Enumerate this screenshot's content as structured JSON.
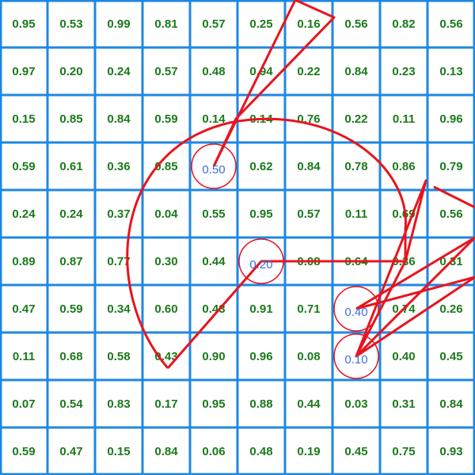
{
  "colors": {
    "grid_line": "#1e88e5",
    "cell_text": "#1b7a1b",
    "path": "#e8141e",
    "marker_text": "#3a6fd8",
    "background": "#ffffff"
  },
  "grid": {
    "rows": 10,
    "cols": 10,
    "values": [
      [
        "0.95",
        "0.53",
        "0.99",
        "0.81",
        "0.57",
        "0.25",
        "0.16",
        "0.56",
        "0.82",
        "0.56"
      ],
      [
        "0.97",
        "0.20",
        "0.24",
        "0.57",
        "0.48",
        "0.94",
        "0.22",
        "0.84",
        "0.23",
        "0.13"
      ],
      [
        "0.15",
        "0.85",
        "0.84",
        "0.59",
        "0.14",
        "0.14",
        "0.76",
        "0.22",
        "0.11",
        "0.96"
      ],
      [
        "0.59",
        "0.61",
        "0.36",
        "0.85",
        "0.50",
        "0.62",
        "0.84",
        "0.78",
        "0.86",
        "0.79"
      ],
      [
        "0.24",
        "0.24",
        "0.37",
        "0.04",
        "0.55",
        "0.95",
        "0.57",
        "0.11",
        "0.69",
        "0.56"
      ],
      [
        "0.89",
        "0.87",
        "0.77",
        "0.30",
        "0.44",
        "0.20",
        "0.08",
        "0.64",
        "0.36",
        "0.31"
      ],
      [
        "0.47",
        "0.59",
        "0.34",
        "0.60",
        "0.43",
        "0.91",
        "0.71",
        "0.40",
        "0.74",
        "0.26"
      ],
      [
        "0.11",
        "0.68",
        "0.58",
        "0.43",
        "0.90",
        "0.96",
        "0.08",
        "0.10",
        "0.40",
        "0.45"
      ],
      [
        "0.07",
        "0.54",
        "0.83",
        "0.17",
        "0.95",
        "0.88",
        "0.44",
        "0.03",
        "0.31",
        "0.84"
      ],
      [
        "0.59",
        "0.47",
        "0.15",
        "0.84",
        "0.06",
        "0.48",
        "0.19",
        "0.45",
        "0.75",
        "0.93"
      ]
    ]
  },
  "markers": [
    {
      "label": "0.50",
      "row": 3,
      "col": 4
    },
    {
      "label": "0.20",
      "row": 5,
      "col": 5
    },
    {
      "label": "0.40",
      "row": 6,
      "col": 7
    },
    {
      "label": "0.10",
      "row": 7,
      "col": 7
    }
  ]
}
